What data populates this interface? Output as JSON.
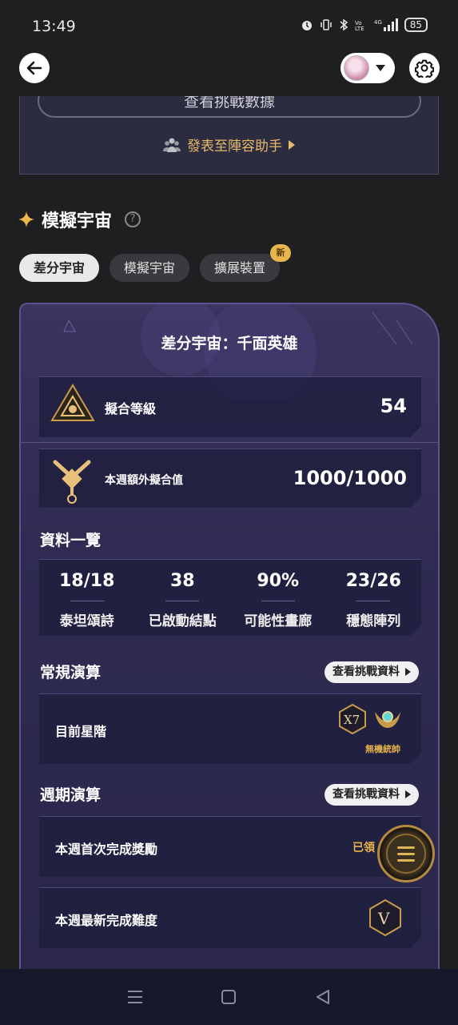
{
  "status_bar": {
    "time": "13:49",
    "battery": "85",
    "icons": [
      "alarm-icon",
      "vibrate-icon",
      "bluetooth-icon",
      "volte-icon",
      "signal-icon"
    ]
  },
  "header": {
    "back_icon": "arrow-left-icon",
    "avatar_icon": "user-avatar",
    "settings_icon": "gear-icon"
  },
  "top_card": {
    "view_data_button": "查看挑戰數據",
    "publish_link": "發表至陣容助手"
  },
  "section": {
    "title": "模擬宇宙"
  },
  "tabs": [
    {
      "label": "差分宇宙",
      "active": true
    },
    {
      "label": "模擬宇宙",
      "active": false
    },
    {
      "label": "擴展裝置",
      "active": false,
      "badge": "新"
    }
  ],
  "card": {
    "title": "差分宇宙：千面英雄",
    "rows": {
      "level_label": "擬合等級",
      "level_value": "54",
      "weekly_label": "本週額外擬合值",
      "weekly_value": "1000/1000"
    },
    "overview_title": "資料一覽",
    "stats": [
      {
        "value": "18/18",
        "label": "泰坦頌詩"
      },
      {
        "value": "38",
        "label": "已啟動結點"
      },
      {
        "value": "90%",
        "label": "可能性畫廊"
      },
      {
        "value": "23/26",
        "label": "穩態陣列"
      }
    ],
    "regular": {
      "title": "常規演算",
      "button": "查看挑戰資料",
      "row_label": "目前星階",
      "rank_badge": "X7",
      "rank_title": "無機統帥"
    },
    "weekly": {
      "title": "週期演算",
      "button": "查看挑戰資料",
      "first_clear_label": "本週首次完成獎勵",
      "first_clear_value": "已領",
      "latest_label": "本週最新完成難度",
      "latest_value": "V"
    }
  },
  "colors": {
    "gold": "#e8b24a",
    "card_bg": "#2f2b52",
    "page_bg": "#1f1f21"
  }
}
